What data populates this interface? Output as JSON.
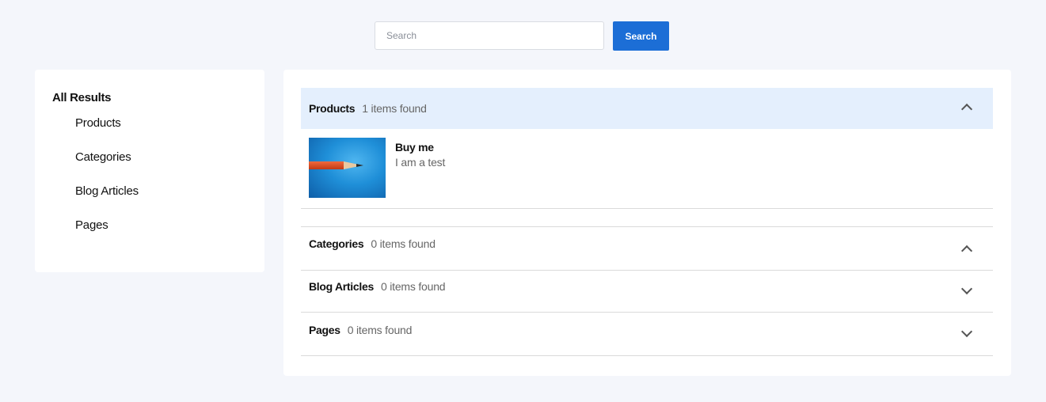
{
  "search": {
    "placeholder": "Search",
    "button_label": "Search"
  },
  "sidebar": {
    "title": "All Results",
    "items": [
      {
        "label": "Products"
      },
      {
        "label": "Categories"
      },
      {
        "label": "Blog Articles"
      },
      {
        "label": "Pages"
      }
    ]
  },
  "sections": {
    "products": {
      "name": "Products",
      "count": "1 items found",
      "expanded": true,
      "chevron": "chevron-up-icon",
      "items": [
        {
          "name": "Buy me",
          "description": "I am a test",
          "image": "pencil-on-blue-image"
        }
      ]
    },
    "categories": {
      "name": "Categories",
      "count": "0 items found",
      "expanded": true,
      "chevron": "chevron-up-icon"
    },
    "blog_articles": {
      "name": "Blog Articles",
      "count": "0 items found",
      "expanded": false,
      "chevron": "chevron-down-icon"
    },
    "pages": {
      "name": "Pages",
      "count": "0 items found",
      "expanded": false,
      "chevron": "chevron-down-icon"
    }
  },
  "colors": {
    "page_background": "#f4f6fb",
    "primary_button": "#1c6ed6",
    "active_section_background": "#e4effd",
    "muted_text": "#666666",
    "divider": "#dadada"
  }
}
